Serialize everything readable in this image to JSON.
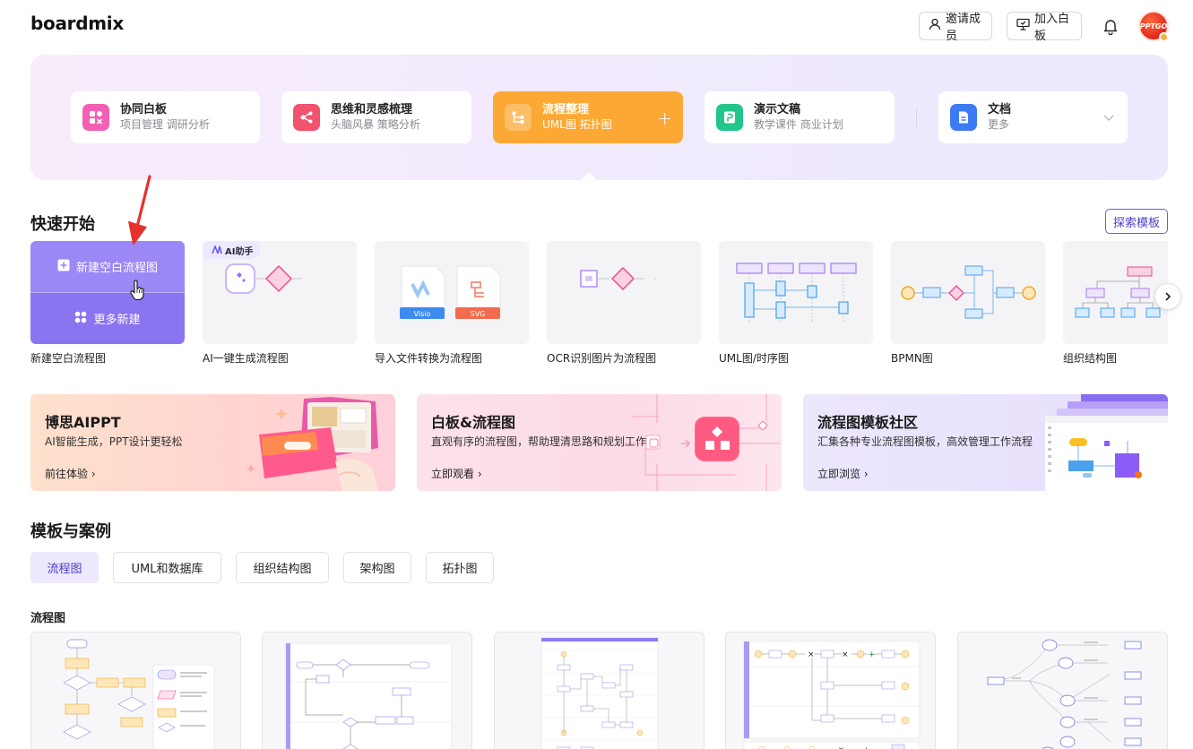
{
  "header": {
    "logo": "boardmix",
    "invite_label": "邀请成员",
    "join_label": "加入白板",
    "avatar_text": "PPTGO"
  },
  "categories": [
    {
      "title": "协同白板",
      "subtitle": "项目管理 调研分析",
      "color": "#f25fb5"
    },
    {
      "title": "思维和灵感梳理",
      "subtitle": "头脑风暴 策略分析",
      "color": "#f2536d"
    },
    {
      "title": "流程整理",
      "subtitle": "UML图 拓扑图",
      "color": "#fba934",
      "plus": "+"
    },
    {
      "title": "演示文稿",
      "subtitle": "教学课件 商业计划",
      "color": "#22c68b"
    },
    {
      "title": "文档",
      "subtitle": "更多",
      "color": "#3d7bf5"
    }
  ],
  "quick_start": {
    "title": "快速开始",
    "explore_label": "探索模板",
    "new_blank_label": "新建空白流程图",
    "more_new_label": "更多新建",
    "ai_badge": "AI助手",
    "visio_tag": "Visio",
    "svg_tag": "SVG",
    "cards": [
      {
        "label": "新建空白流程图"
      },
      {
        "label": "AI一键生成流程图"
      },
      {
        "label": "导入文件转换为流程图"
      },
      {
        "label": "OCR识别图片为流程图"
      },
      {
        "label": "UML图/时序图"
      },
      {
        "label": "BPMN图"
      },
      {
        "label": "组织结构图"
      }
    ]
  },
  "banners": [
    {
      "title": "博思AIPPT",
      "subtitle": "AI智能生成，PPT设计更轻松",
      "link": "前往体验"
    },
    {
      "title": "白板&流程图",
      "subtitle": "直观有序的流程图，帮助理清思路和规划工作",
      "link": "立即观看"
    },
    {
      "title": "流程图模板社区",
      "subtitle": "汇集各种专业流程图模板，高效管理工作流程",
      "link": "立即浏览"
    }
  ],
  "templates": {
    "title": "模板与案例",
    "tabs": [
      "流程图",
      "UML和数据库",
      "组织结构图",
      "架构图",
      "拓扑图"
    ],
    "active_tab": "流程图",
    "section_title": "流程图"
  }
}
